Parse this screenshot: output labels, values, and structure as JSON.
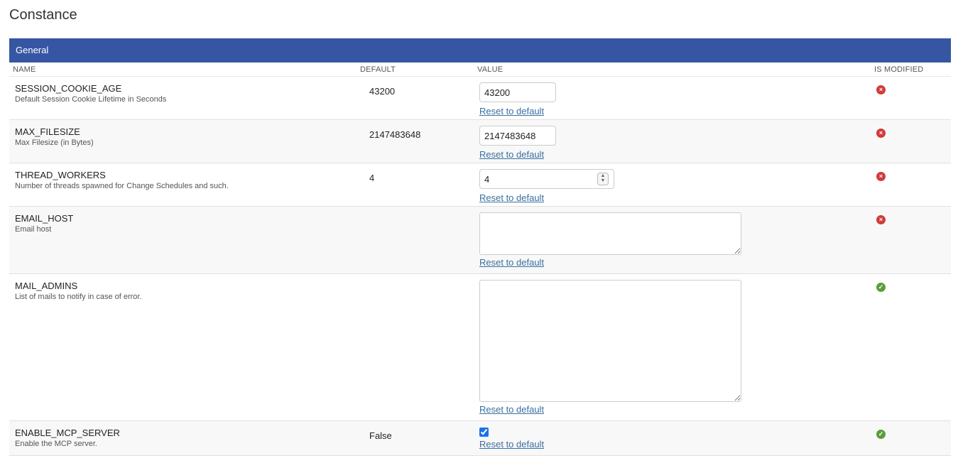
{
  "page": {
    "title": "Constance"
  },
  "section": {
    "title": "General"
  },
  "columns": {
    "name": "NAME",
    "default": "DEFAULT",
    "value": "VALUE",
    "is_modified": "IS MODIFIED"
  },
  "reset_label": "Reset to default",
  "colors": {
    "header_bg": "#3656a4",
    "not_modified": "#d23a3a",
    "modified": "#5a9e3a",
    "link": "#3a6fa0"
  },
  "rows": [
    {
      "name": "SESSION_COOKIE_AGE",
      "help": "Default Session Cookie Lifetime in Seconds",
      "default": "43200",
      "value": "43200",
      "input": "text",
      "is_modified": false,
      "status_icon": "x-circle-icon"
    },
    {
      "name": "MAX_FILESIZE",
      "help": "Max Filesize (in Bytes)",
      "default": "2147483648",
      "value": "2147483648",
      "input": "text",
      "is_modified": false,
      "status_icon": "x-circle-icon"
    },
    {
      "name": "THREAD_WORKERS",
      "help": "Number of threads spawned for Change Schedules and such.",
      "default": "4",
      "value": "4",
      "input": "number",
      "is_modified": false,
      "status_icon": "x-circle-icon"
    },
    {
      "name": "EMAIL_HOST",
      "help": "Email host",
      "default": "",
      "value": "",
      "input": "textarea",
      "is_modified": false,
      "status_icon": "x-circle-icon"
    },
    {
      "name": "MAIL_ADMINS",
      "help": "List of mails to notify in case of error.",
      "default": "",
      "value": "",
      "input": "textarea",
      "is_modified": true,
      "status_icon": "check-circle-icon"
    },
    {
      "name": "ENABLE_MCP_SERVER",
      "help": "Enable the MCP server.",
      "default": "False",
      "value": true,
      "input": "checkbox",
      "is_modified": true,
      "status_icon": "check-circle-icon"
    }
  ]
}
